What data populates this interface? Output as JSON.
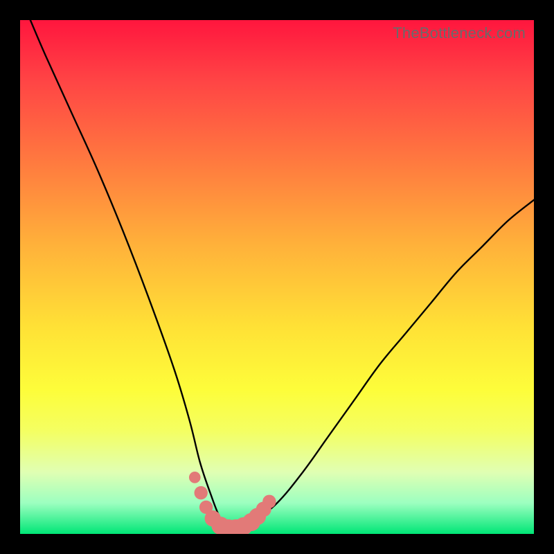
{
  "watermark": "TheBottleneck.com",
  "chart_data": {
    "type": "line",
    "title": "",
    "xlabel": "",
    "ylabel": "",
    "xlim": [
      0,
      100
    ],
    "ylim": [
      0,
      100
    ],
    "grid": false,
    "series": [
      {
        "name": "bottleneck-curve",
        "x": [
          2,
          5,
          10,
          15,
          20,
          25,
          30,
          33,
          35,
          37,
          39,
          41,
          43,
          45,
          50,
          55,
          60,
          65,
          70,
          75,
          80,
          85,
          90,
          95,
          100
        ],
        "y": [
          100,
          93,
          82,
          71,
          59,
          46,
          32,
          22,
          14,
          8,
          3,
          1,
          1,
          2,
          6,
          12,
          19,
          26,
          33,
          39,
          45,
          51,
          56,
          61,
          65
        ]
      }
    ],
    "markers": {
      "name": "highlight-dots",
      "color": "#e27a78",
      "points": [
        {
          "x": 34.0,
          "y": 11.0,
          "r": 0.8
        },
        {
          "x": 35.2,
          "y": 8.0,
          "r": 1.0
        },
        {
          "x": 36.2,
          "y": 5.2,
          "r": 1.0
        },
        {
          "x": 37.5,
          "y": 3.0,
          "r": 1.3
        },
        {
          "x": 39.0,
          "y": 1.6,
          "r": 1.5
        },
        {
          "x": 40.5,
          "y": 1.1,
          "r": 1.5
        },
        {
          "x": 42.0,
          "y": 1.1,
          "r": 1.5
        },
        {
          "x": 43.5,
          "y": 1.5,
          "r": 1.5
        },
        {
          "x": 45.0,
          "y": 2.3,
          "r": 1.5
        },
        {
          "x": 46.2,
          "y": 3.4,
          "r": 1.4
        },
        {
          "x": 47.4,
          "y": 4.8,
          "r": 1.2
        },
        {
          "x": 48.5,
          "y": 6.3,
          "r": 1.0
        }
      ]
    },
    "gradient_stops": [
      {
        "pos": 0,
        "color": "#ff163e"
      },
      {
        "pos": 12,
        "color": "#ff4545"
      },
      {
        "pos": 28,
        "color": "#ff7b3f"
      },
      {
        "pos": 44,
        "color": "#ffb23a"
      },
      {
        "pos": 60,
        "color": "#ffe236"
      },
      {
        "pos": 72,
        "color": "#fdfd3a"
      },
      {
        "pos": 80,
        "color": "#f4ff62"
      },
      {
        "pos": 88,
        "color": "#e0ffb3"
      },
      {
        "pos": 94,
        "color": "#9cffc0"
      },
      {
        "pos": 100,
        "color": "#00e676"
      }
    ]
  }
}
